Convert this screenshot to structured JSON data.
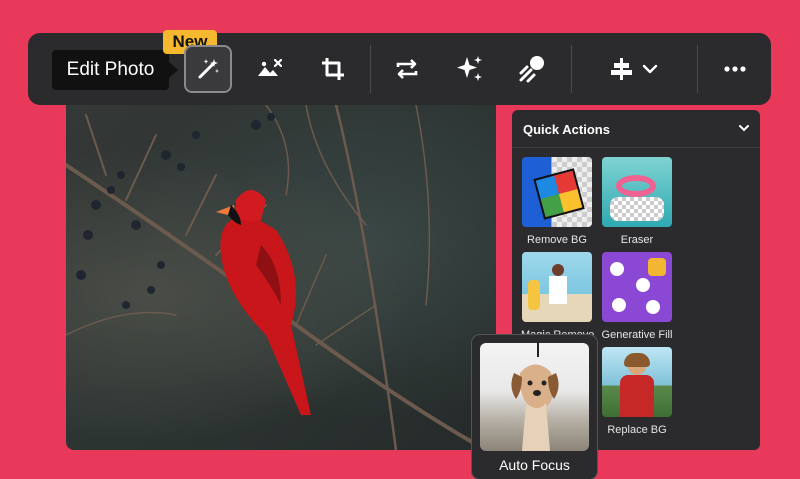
{
  "toolbar": {
    "tooltip": "Edit Photo",
    "badge": "New",
    "buttons": [
      {
        "icon": "magic-wand-icon"
      },
      {
        "icon": "image-remove-icon"
      },
      {
        "icon": "crop-icon"
      },
      {
        "icon": "swap-icon"
      },
      {
        "icon": "sparkle-icon"
      },
      {
        "icon": "style-transfer-icon"
      },
      {
        "icon": "align-icon"
      },
      {
        "icon": "more-icon"
      }
    ]
  },
  "quick_actions": {
    "title": "Quick Actions",
    "items": [
      {
        "label": "Remove BG"
      },
      {
        "label": "Eraser"
      },
      {
        "label": "Magic Remove"
      },
      {
        "label": "Generative Fill"
      },
      {
        "label": "Replace BG"
      }
    ]
  },
  "auto_focus": {
    "label": "Auto Focus"
  },
  "colors": {
    "background": "#e8395a",
    "badge": "#f5b82e",
    "panel": "#2b2b2d"
  }
}
